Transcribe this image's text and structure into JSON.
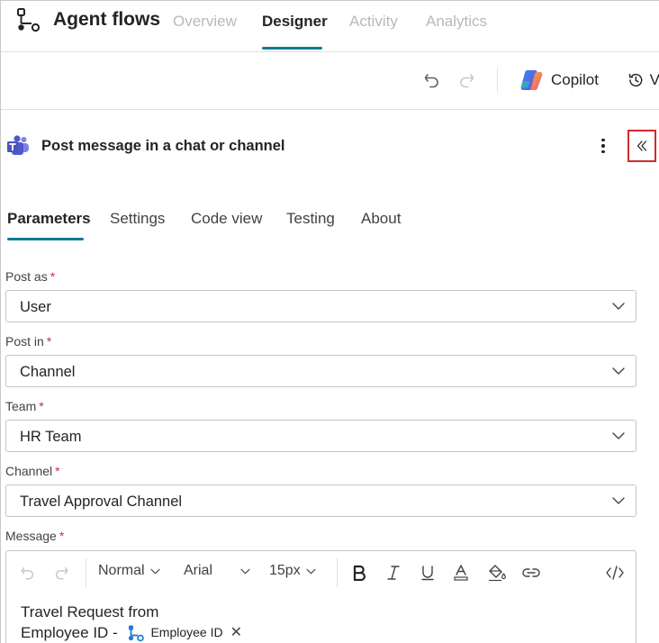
{
  "header": {
    "app_title": "Agent flows",
    "tabs": [
      {
        "label": "Overview"
      },
      {
        "label": "Designer"
      },
      {
        "label": "Activity"
      },
      {
        "label": "Analytics"
      }
    ],
    "active_tab": "Designer"
  },
  "toolbar": {
    "undo_icon": "undo-icon",
    "redo_icon": "redo-icon",
    "copilot_label": "Copilot",
    "version_icon": "history-icon",
    "version_label_partial": "V"
  },
  "panel": {
    "title": "Post message in a chat or channel",
    "icon": "teams-icon",
    "tabs": [
      {
        "label": "Parameters"
      },
      {
        "label": "Settings"
      },
      {
        "label": "Code view"
      },
      {
        "label": "Testing"
      },
      {
        "label": "About"
      }
    ],
    "active_tab": "Parameters"
  },
  "form": {
    "required_mark": "*",
    "fields": [
      {
        "label": "Post as",
        "value": "User"
      },
      {
        "label": "Post in",
        "value": "Channel"
      },
      {
        "label": "Team",
        "value": "HR Team"
      },
      {
        "label": "Channel",
        "value": "Travel Approval Channel"
      }
    ],
    "message": {
      "label": "Message",
      "toolbar": {
        "style_select": "Normal",
        "font_select": "Arial",
        "size_select": "15px"
      },
      "text_line1": "Travel Request from",
      "text_line2": "Employee ID - ",
      "token_label": "Employee ID",
      "token_remove": "✕"
    }
  },
  "colors": {
    "accent": "#107c98",
    "required": "#c4314b",
    "highlight_box": "#d42a2a",
    "inactive_nav": "#b9b9b9"
  }
}
